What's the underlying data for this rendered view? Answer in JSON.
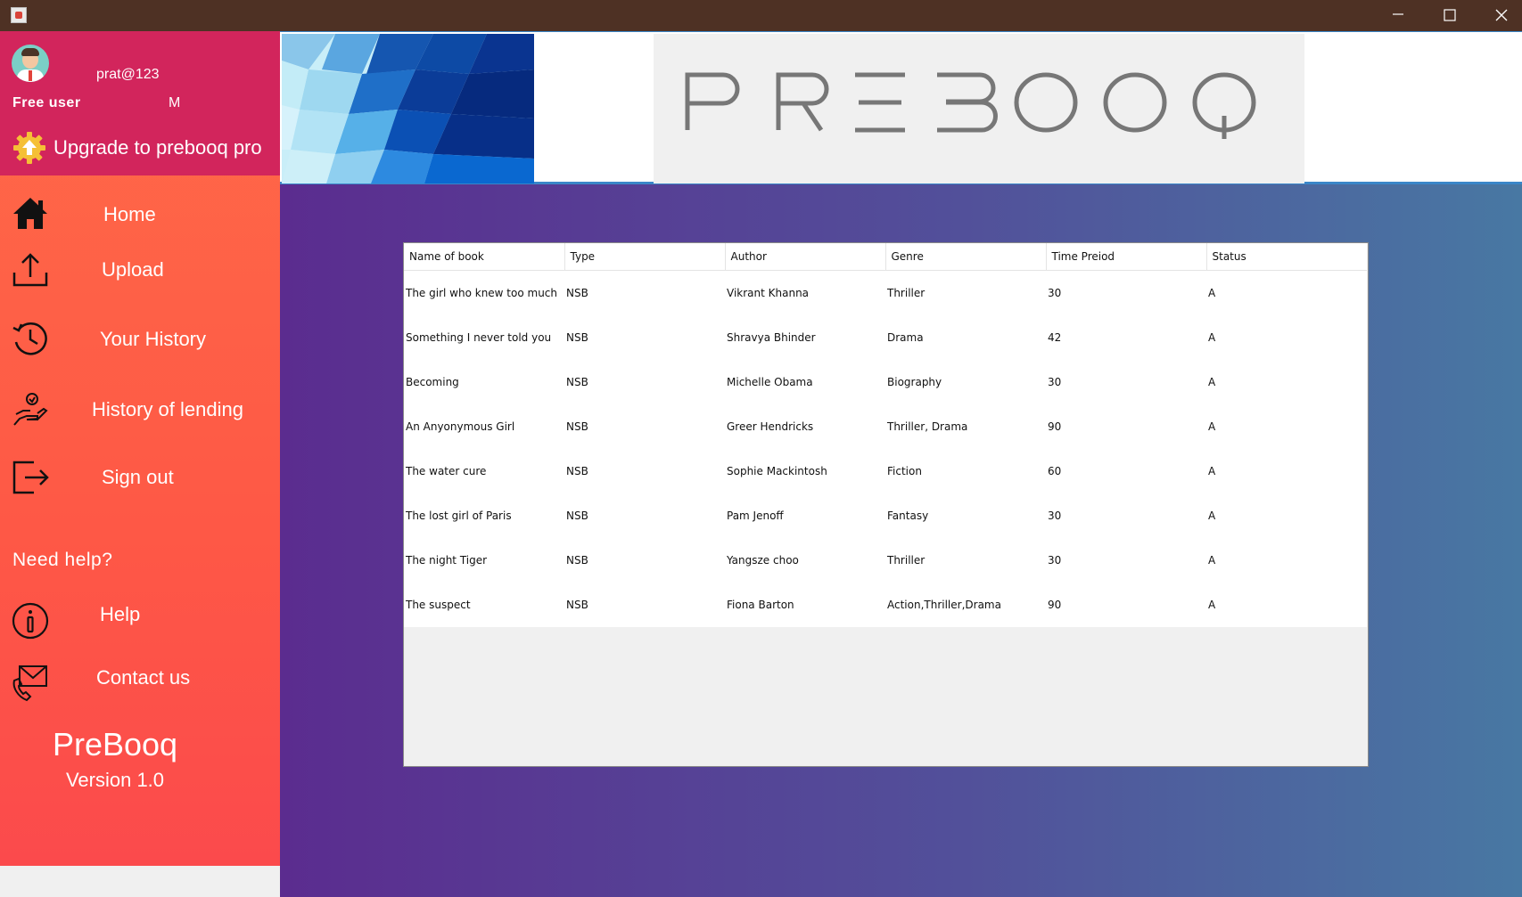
{
  "window": {
    "controls": [
      "minimize-icon",
      "maximize-icon",
      "close-icon"
    ]
  },
  "sidebar": {
    "username": "prat@123",
    "role": "Free user",
    "gender": "M",
    "upgrade_label": "Upgrade to prebooq pro",
    "nav": [
      {
        "label": "Home",
        "icon": "home-icon"
      },
      {
        "label": "Upload",
        "icon": "upload-icon"
      },
      {
        "label": "Your History",
        "icon": "history-icon"
      },
      {
        "label": "History of lending",
        "icon": "lending-hand-icon"
      },
      {
        "label": "Sign out",
        "icon": "sign-out-icon"
      }
    ],
    "help_heading": "Need help?",
    "help_nav": [
      {
        "label": "Help",
        "icon": "info-icon"
      },
      {
        "label": "Contact us",
        "icon": "contact-mail-icon"
      }
    ],
    "brand_name": "PreBooq",
    "version": "Version 1.0"
  },
  "banner": {
    "logo_text": "PREBOOQ"
  },
  "table": {
    "columns": [
      "Name of book",
      "Type",
      "Author",
      "Genre",
      "Time Preiod",
      "Status"
    ],
    "rows": [
      [
        "The girl who knew too much",
        "NSB",
        "Vikrant Khanna",
        "Thriller",
        "30",
        "A"
      ],
      [
        "Something I never told you",
        "NSB",
        "Shravya Bhinder",
        "Drama",
        "42",
        "A"
      ],
      [
        "Becoming",
        "NSB",
        "Michelle Obama",
        "Biography",
        "30",
        "A"
      ],
      [
        "An Anyonymous Girl",
        "NSB",
        "Greer Hendricks",
        "Thriller, Drama",
        "90",
        "A"
      ],
      [
        "The water cure",
        "NSB",
        "Sophie Mackintosh",
        "Fiction",
        "60",
        "A"
      ],
      [
        "The lost girl of Paris",
        "NSB",
        "Pam Jenoff",
        "Fantasy",
        "30",
        "A"
      ],
      [
        "The night Tiger",
        "NSB",
        "Yangsze choo",
        "Thriller",
        "30",
        "A"
      ],
      [
        "The suspect",
        "NSB",
        "Fiona Barton",
        "Action,Thriller,Drama",
        "90",
        "A"
      ]
    ]
  },
  "colors": {
    "titlebar": "#4e3124",
    "profile_bg": "#d2255c",
    "sidebar_bg": "#ff6a48",
    "content_gradient_start": "#5b2c8f",
    "content_gradient_end": "#4878a3",
    "banner_border": "#3a86c8"
  }
}
